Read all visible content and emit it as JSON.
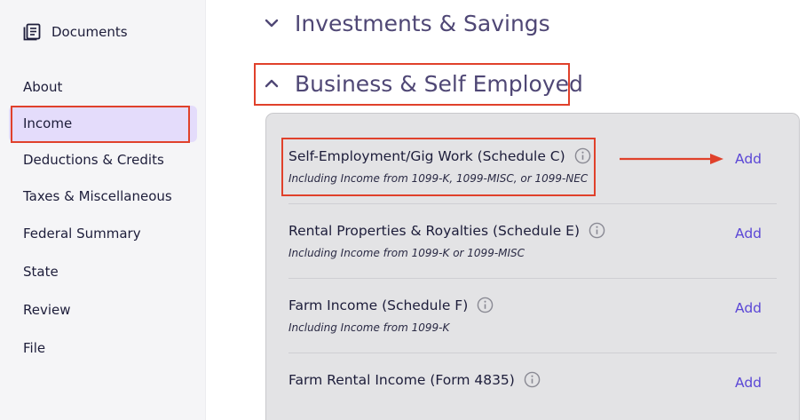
{
  "sidebar": {
    "documents_label": "Documents",
    "items": [
      {
        "label": "About"
      },
      {
        "label": "Income"
      },
      {
        "label": "Deductions & Credits"
      },
      {
        "label": "Taxes & Miscellaneous"
      },
      {
        "label": "Federal Summary"
      },
      {
        "label": "State"
      },
      {
        "label": "Review"
      },
      {
        "label": "File"
      }
    ],
    "active_item": "Income"
  },
  "sections": {
    "investments": {
      "title": "Investments & Savings",
      "icon": "chevron-down-icon"
    },
    "business": {
      "title": "Business & Self Employed",
      "icon": "chevron-up-icon"
    }
  },
  "rows": [
    {
      "title": "Self-Employment/Gig Work (Schedule C)",
      "subtitle": "Including Income from 1099-K, 1099-MISC, or 1099-NEC",
      "action": "Add"
    },
    {
      "title": "Rental Properties & Royalties (Schedule E)",
      "subtitle": "Including Income from 1099-K or 1099-MISC",
      "action": "Add"
    },
    {
      "title": "Farm Income (Schedule F)",
      "subtitle": "Including Income from 1099-K",
      "action": "Add"
    },
    {
      "title": "Farm Rental Income (Form 4835)",
      "subtitle": "",
      "action": "Add"
    }
  ],
  "colors": {
    "highlight": "#e0412b",
    "accent": "#5b47d6",
    "section_title": "#4f4775",
    "active_nav": "#e4dcfb"
  }
}
